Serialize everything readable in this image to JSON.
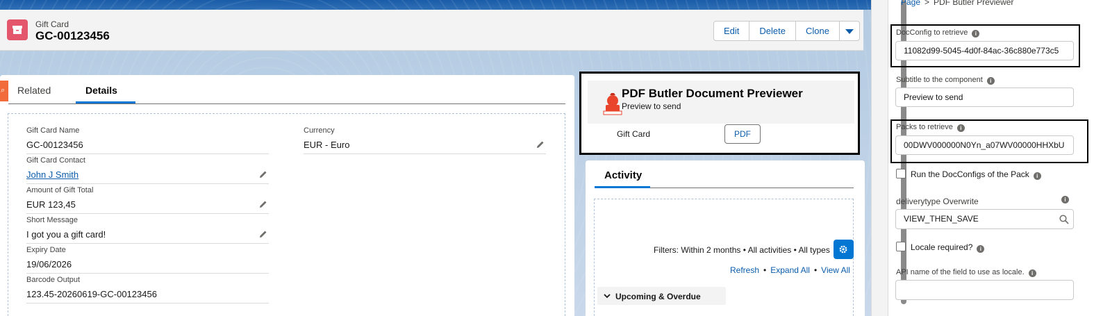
{
  "record": {
    "type_label": "Gift Card",
    "title": "GC-00123456",
    "actions": [
      "Edit",
      "Delete",
      "Clone"
    ]
  },
  "tabs": {
    "related": "Related",
    "details": "Details"
  },
  "fields": {
    "gift_card_name": {
      "label": "Gift Card Name",
      "value": "GC-00123456"
    },
    "currency": {
      "label": "Currency",
      "value": "EUR - Euro"
    },
    "gift_card_contact": {
      "label": "Gift Card Contact",
      "value": "John J Smith"
    },
    "amount": {
      "label": "Amount of Gift Total",
      "value": "EUR 123,45"
    },
    "short_message": {
      "label": "Short Message",
      "value": "I got you a gift card!"
    },
    "expiry_date": {
      "label": "Expiry Date",
      "value": "19/06/2026"
    },
    "barcode_output": {
      "label": "Barcode Output",
      "value": "123.45-20260619-GC-00123456"
    }
  },
  "pdf_butler": {
    "title": "PDF Butler Document Previewer",
    "subtitle": "Preview to send",
    "row_label": "Gift Card",
    "button": "PDF"
  },
  "activity": {
    "title": "Activity",
    "filters": "Filters: Within 2 months • All activities • All types",
    "links": [
      "Refresh",
      "Expand All",
      "View All"
    ],
    "section": "Upcoming & Overdue"
  },
  "panel": {
    "breadcrumb_root": "Page",
    "breadcrumb_sep": ">",
    "breadcrumb_current": "PDF Butler Previewer",
    "docconfig_label": "DocConfig to retrieve",
    "docconfig_value": "11082d99-5045-4d0f-84ac-36c880e773c5",
    "subtitle_label": "Subtitle to the component",
    "subtitle_value": "Preview to send",
    "packs_label": "Packs to retrieve",
    "packs_value": "00DWV000000N0Yn_a07WV00000HHXbU",
    "run_pack_label": "Run the DocConfigs of the Pack",
    "delivery_label": "deliverytype Overwrite",
    "delivery_value": "VIEW_THEN_SAVE",
    "locale_label": "Locale required?",
    "api_locale_label": "API name of the field to use as locale."
  },
  "colors": {
    "brand_blue": "#0176d3",
    "link_blue": "#0b5cab",
    "gift_icon": "#e3566b",
    "orange_tab": "#f26b3a"
  },
  "icons": [
    "gift-card-icon",
    "pencil-icon",
    "chevron-down-icon",
    "gear-icon",
    "info-icon",
    "search-icon",
    "pdf-butler-logo-icon"
  ]
}
